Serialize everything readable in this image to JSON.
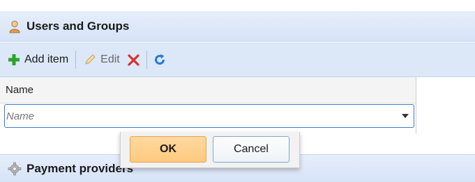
{
  "users_panel": {
    "title": "Users and Groups",
    "icon": "user-icon"
  },
  "toolbar": {
    "add_label": "Add item",
    "edit_label": "Edit",
    "delete_icon": "delete-icon",
    "refresh_icon": "refresh-icon",
    "colors": {
      "add": "#2aa52a",
      "delete": "#d9312b",
      "refresh": "#2a78d6"
    }
  },
  "grid": {
    "column_header": "Name",
    "filter": {
      "placeholder": "Name",
      "value": ""
    }
  },
  "popup": {
    "ok_label": "OK",
    "cancel_label": "Cancel"
  },
  "payment_panel": {
    "title": "Payment providers",
    "icon": "gear-icon"
  }
}
